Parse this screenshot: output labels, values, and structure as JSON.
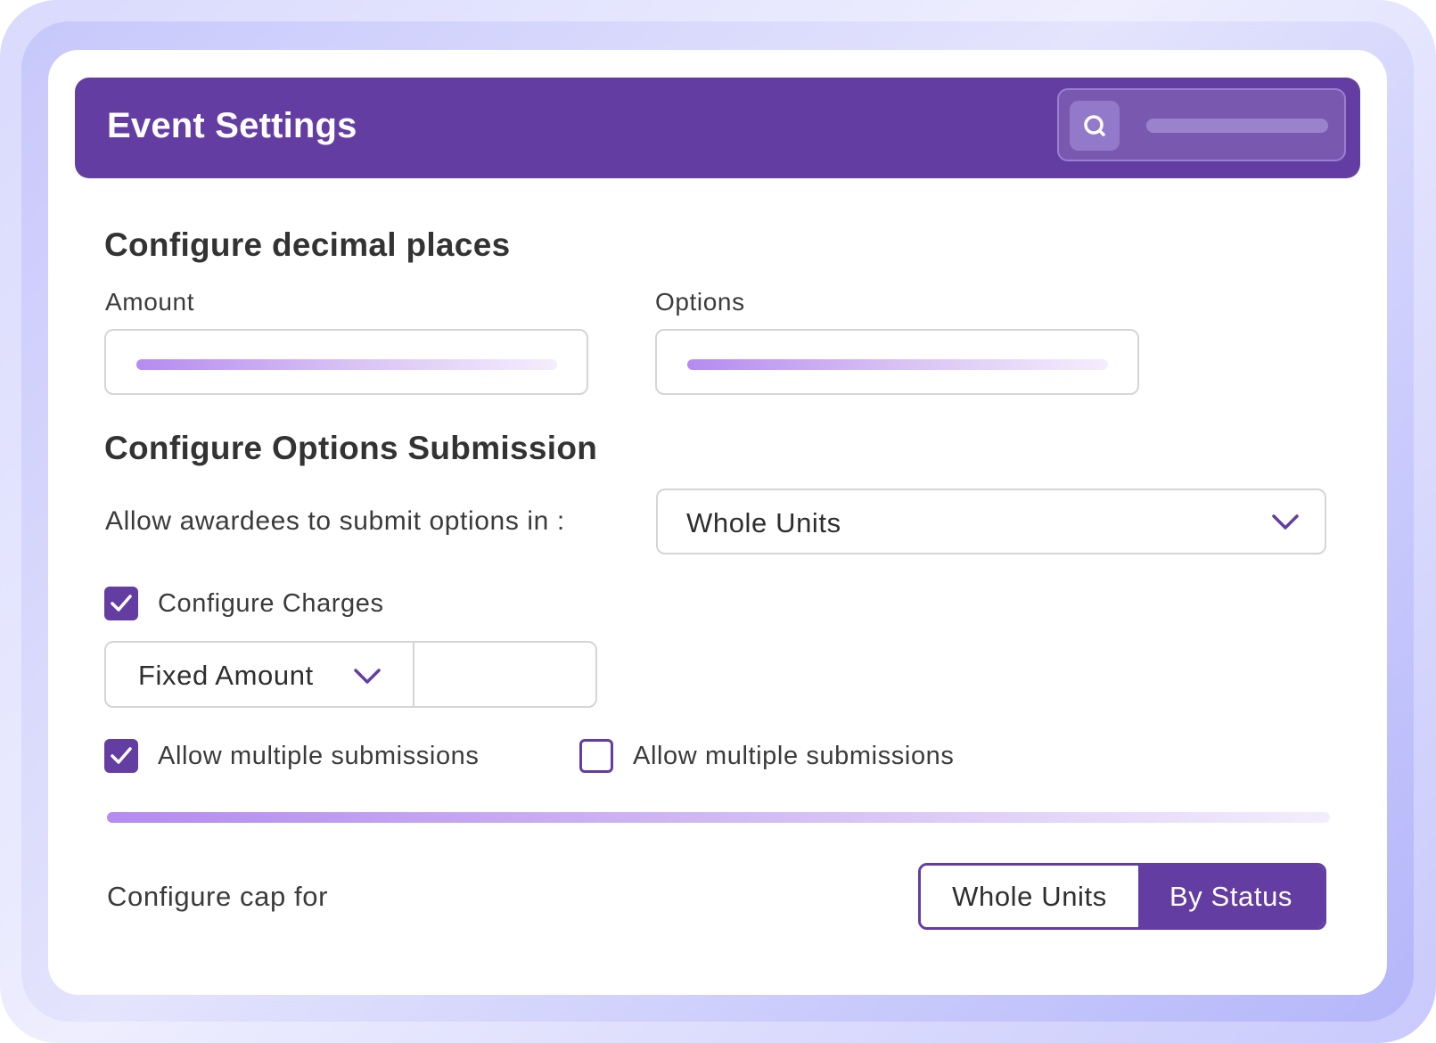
{
  "header": {
    "title": "Event Settings"
  },
  "decimal_section": {
    "heading": "Configure decimal places",
    "amount_label": "Amount",
    "options_label": "Options"
  },
  "submission_section": {
    "heading": "Configure Options Submission",
    "submit_in_label": "Allow awardees to submit options in :",
    "submit_in_value": "Whole Units",
    "configure_charges": {
      "label": "Configure Charges",
      "checked": true
    },
    "charge_type_value": "Fixed Amount",
    "multiple_submissions_1": {
      "label": "Allow multiple submissions",
      "checked": true
    },
    "multiple_submissions_2": {
      "label": "Allow multiple submissions",
      "checked": false
    }
  },
  "cap_section": {
    "label": "Configure cap for",
    "options": [
      "Whole Units",
      "By Status"
    ],
    "selected": "By Status"
  },
  "colors": {
    "accent": "#643da3",
    "border": "#d5d5d9",
    "text": "#333333"
  },
  "icons": {
    "search": "search-icon",
    "chevron": "chevron-down-icon",
    "check": "check-icon"
  }
}
